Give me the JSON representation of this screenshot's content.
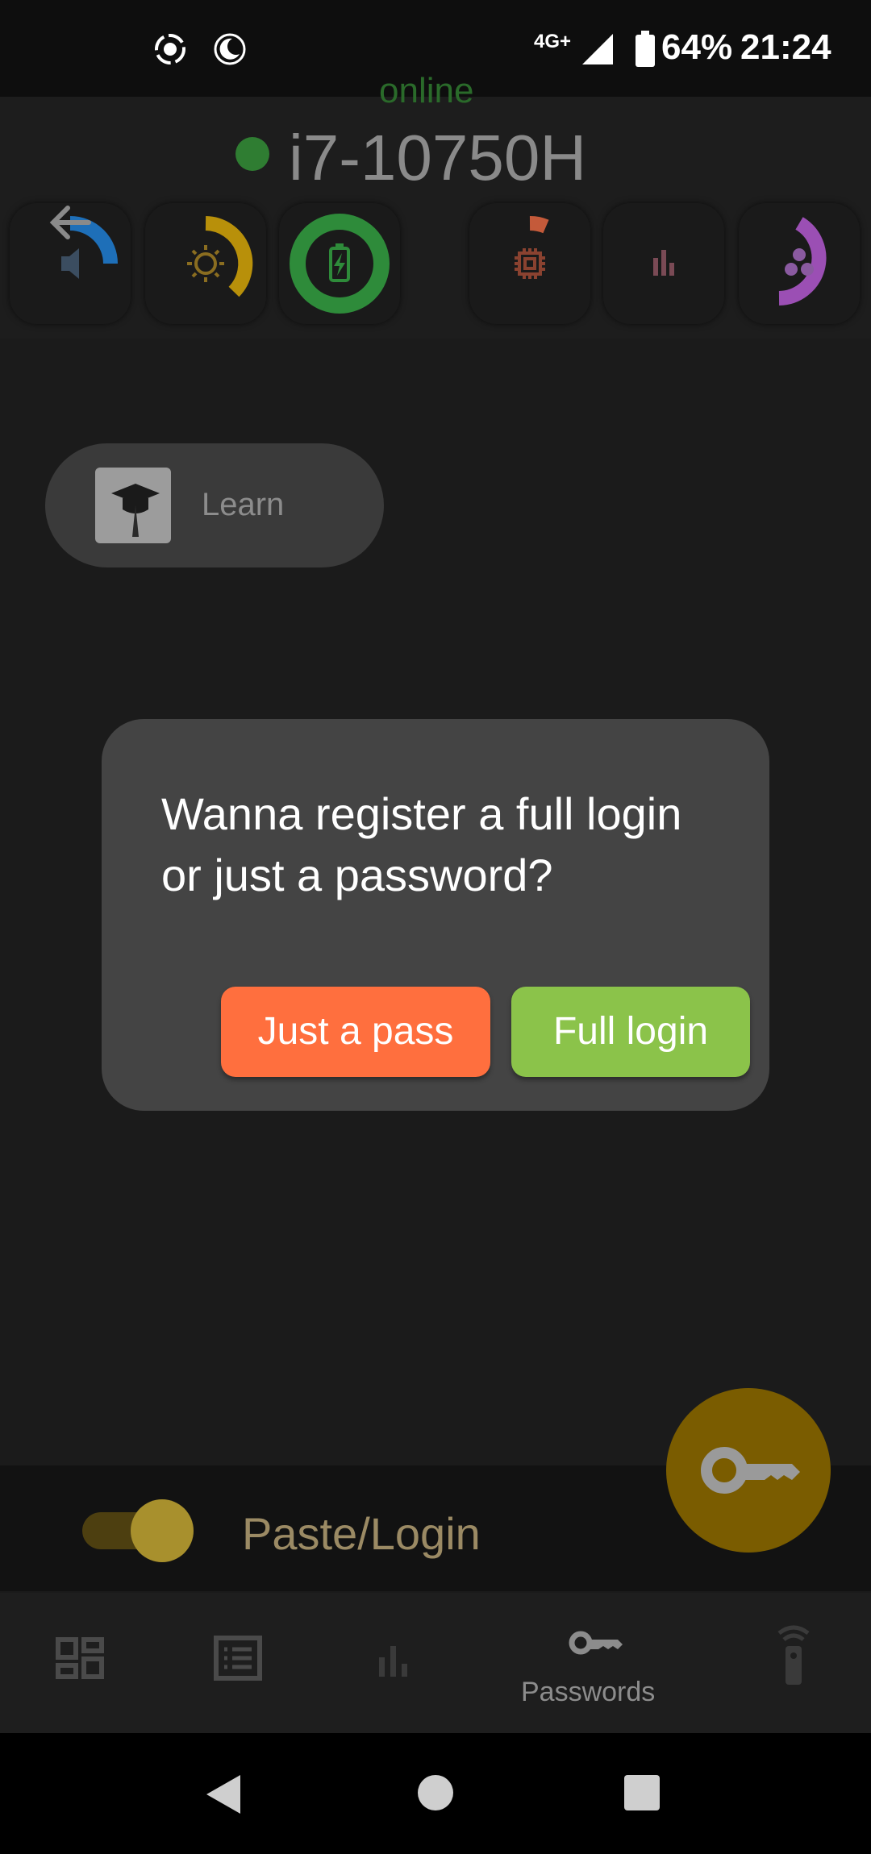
{
  "status_bar": {
    "network": "4G+",
    "battery": "64%",
    "time": "21:24",
    "icons": [
      "screen-record-icon",
      "do-not-disturb-moon-icon",
      "signal-icon",
      "battery-icon"
    ]
  },
  "header": {
    "status": "online",
    "host": "i7-10750H",
    "gauges": [
      {
        "name": "volume-gauge",
        "icon": "speaker-icon",
        "color": "#1e6fb8"
      },
      {
        "name": "brightness-gauge",
        "icon": "sun-icon",
        "color": "#b8900a"
      },
      {
        "name": "battery-gauge",
        "icon": "battery-charging-icon",
        "color": "#2e8b3a"
      },
      {
        "name": "cpu-gauge",
        "icon": "cpu-chip-icon",
        "color": "#c45a3a"
      },
      {
        "name": "stats-gauge",
        "icon": "bar-chart-icon",
        "color": "#c07080"
      },
      {
        "name": "processes-gauge",
        "icon": "circles-icon",
        "color": "#9b4fb4"
      }
    ]
  },
  "main": {
    "learn_label": "Learn"
  },
  "dialog": {
    "message": "Wanna register a full login or just a password?",
    "just_pass_label": "Just a pass",
    "full_login_label": "Full login"
  },
  "toggle": {
    "label": "Paste/Login"
  },
  "bottom_nav": {
    "items": [
      {
        "icon": "dashboard-icon"
      },
      {
        "icon": "list-icon"
      },
      {
        "icon": "bar-chart-icon"
      },
      {
        "icon": "key-icon",
        "label": "Passwords",
        "active": true
      },
      {
        "icon": "remote-icon"
      }
    ]
  },
  "colors": {
    "accent_orange": "#ff6f3e",
    "accent_green": "#8bc34a",
    "fab": "#7a5c00"
  }
}
